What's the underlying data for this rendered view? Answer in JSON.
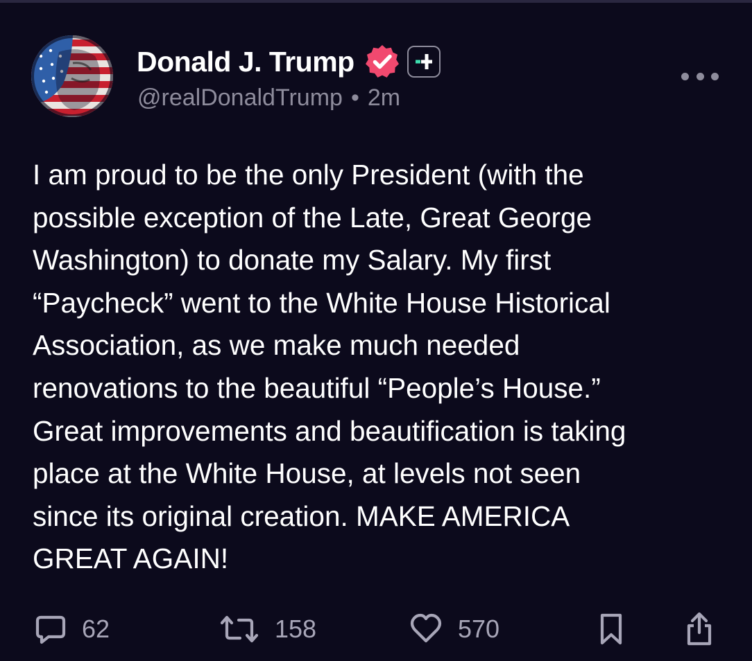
{
  "author": {
    "display_name": "Donald J. Trump",
    "handle": "@realDonaldTrump",
    "separator": "•",
    "time_ago": "2m",
    "verified": true
  },
  "post": {
    "lines": [
      "I am proud to be the only President (with the",
      "possible exception of the Late, Great George",
      "Washington) to donate my Salary. My first",
      "“Paycheck” went to the White House Historical",
      "Association, as we make much needed",
      "renovations to the beautiful “People’s House.”",
      "Great improvements and beautification is taking",
      "place at the White House, at levels not seen",
      "since its original creation. MAKE AMERICA",
      "GREAT AGAIN!"
    ]
  },
  "actions": {
    "reply_count": "62",
    "retruth_count": "158",
    "like_count": "570"
  },
  "icons": {
    "verified": "verified-badge-icon",
    "plus": "truth-plus-icon",
    "more": "more-dots-icon",
    "reply": "comment-bubble-icon",
    "retruth": "repost-arrows-icon",
    "like": "heart-icon",
    "bookmark": "bookmark-icon",
    "share": "share-icon"
  },
  "colors": {
    "background": "#0c0a1c",
    "text": "#ffffff",
    "muted": "#8e8c9c",
    "verified_badge": "#f1496f",
    "plus_accent": "#3ee0b0"
  }
}
